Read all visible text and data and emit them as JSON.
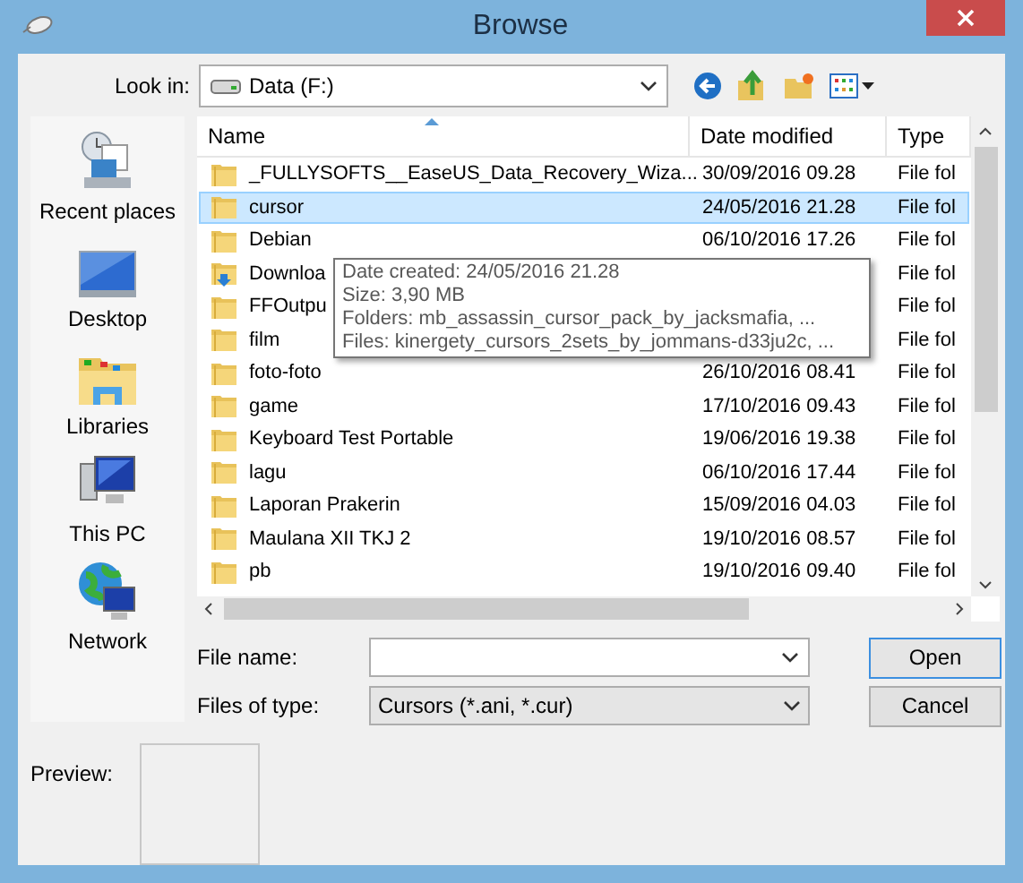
{
  "window": {
    "title": "Browse"
  },
  "look_in": {
    "label": "Look in:",
    "value": "Data (F:)"
  },
  "sidebar": {
    "items": [
      {
        "label": "Recent places",
        "kind": "recent"
      },
      {
        "label": "Desktop",
        "kind": "desktop"
      },
      {
        "label": "Libraries",
        "kind": "libraries"
      },
      {
        "label": "This PC",
        "kind": "pc"
      },
      {
        "label": "Network",
        "kind": "network"
      }
    ]
  },
  "table": {
    "columns": [
      "Name",
      "Date modified",
      "Type"
    ],
    "rows": [
      {
        "name": "_FULLYSOFTS__EaseUS_Data_Recovery_Wiza...",
        "date": "30/09/2016 09.28",
        "type": "File fol",
        "selected": false,
        "kind": "folder"
      },
      {
        "name": "cursor",
        "date": "24/05/2016 21.28",
        "type": "File fol",
        "selected": true,
        "kind": "folder"
      },
      {
        "name": "Debian",
        "date": "06/10/2016 17.26",
        "type": "File fol",
        "selected": false,
        "kind": "folder"
      },
      {
        "name": "Downloa",
        "type": "File fol",
        "selected": false,
        "kind": "download"
      },
      {
        "name": "FFOutpu",
        "type": "File fol",
        "selected": false,
        "kind": "folder"
      },
      {
        "name": "film",
        "type": "File fol",
        "selected": false,
        "kind": "folder"
      },
      {
        "name": "foto-foto",
        "date": "26/10/2016 08.41",
        "type": "File fol",
        "selected": false,
        "kind": "folder"
      },
      {
        "name": "game",
        "date": "17/10/2016 09.43",
        "type": "File fol",
        "selected": false,
        "kind": "folder"
      },
      {
        "name": "Keyboard Test Portable",
        "date": "19/06/2016 19.38",
        "type": "File fol",
        "selected": false,
        "kind": "folder"
      },
      {
        "name": "lagu",
        "date": "06/10/2016 17.44",
        "type": "File fol",
        "selected": false,
        "kind": "folder"
      },
      {
        "name": "Laporan Prakerin",
        "date": "15/09/2016 04.03",
        "type": "File fol",
        "selected": false,
        "kind": "folder"
      },
      {
        "name": "Maulana XII TKJ 2",
        "date": "19/10/2016 08.57",
        "type": "File fol",
        "selected": false,
        "kind": "folder"
      },
      {
        "name": "pb",
        "date": "19/10/2016 09.40",
        "type": "File fol",
        "selected": false,
        "kind": "folder"
      }
    ]
  },
  "tooltip": {
    "lines": [
      "Date created: 24/05/2016 21.28",
      "Size: 3,90 MB",
      "Folders: mb_assassin_cursor_pack_by_jacksmafia, ...",
      "Files: kinergety_cursors_2sets_by_jommans-d33ju2c, ..."
    ]
  },
  "file_name": {
    "label": "File name:"
  },
  "file_type": {
    "label": "Files of type:",
    "value": "Cursors (*.ani, *.cur)"
  },
  "buttons": [
    {
      "label": "Open",
      "kind": "default"
    },
    {
      "label": "Cancel",
      "kind": "normal"
    }
  ],
  "preview": {
    "label": "Preview:"
  }
}
